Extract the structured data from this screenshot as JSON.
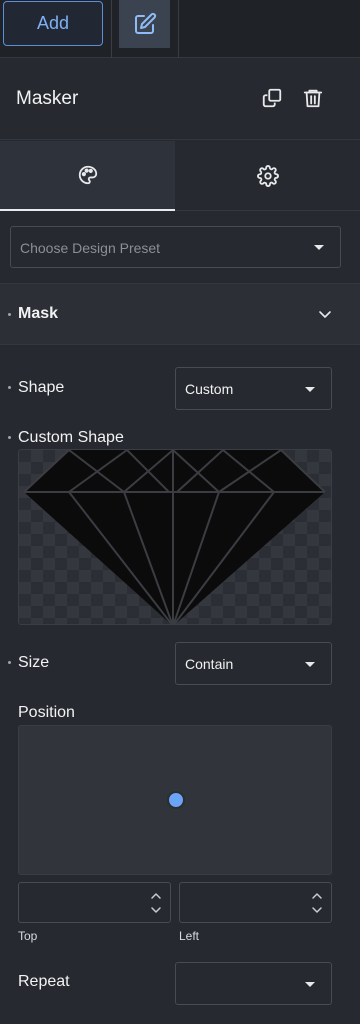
{
  "topbar": {
    "add_label": "Add",
    "edit_icon": "edit-icon"
  },
  "header": {
    "title": "Masker",
    "duplicate_icon": "duplicate-icon",
    "delete_icon": "trash-icon"
  },
  "tabs": [
    {
      "name": "style",
      "icon": "palette-icon",
      "active": true
    },
    {
      "name": "settings",
      "icon": "gear-icon",
      "active": false
    }
  ],
  "preset": {
    "placeholder": "Choose Design Preset"
  },
  "section": {
    "title": "Mask"
  },
  "fields": {
    "shape": {
      "label": "Shape",
      "value": "Custom"
    },
    "custom_shape": {
      "label": "Custom Shape"
    },
    "size": {
      "label": "Size",
      "value": "Contain"
    },
    "position": {
      "label": "Position",
      "top_label": "Top",
      "left_label": "Left",
      "top_value": "",
      "left_value": ""
    },
    "repeat": {
      "label": "Repeat",
      "value": ""
    }
  },
  "colors": {
    "accent": "#6aa4f2",
    "background": "#26292f",
    "panel": "#1f2227"
  }
}
